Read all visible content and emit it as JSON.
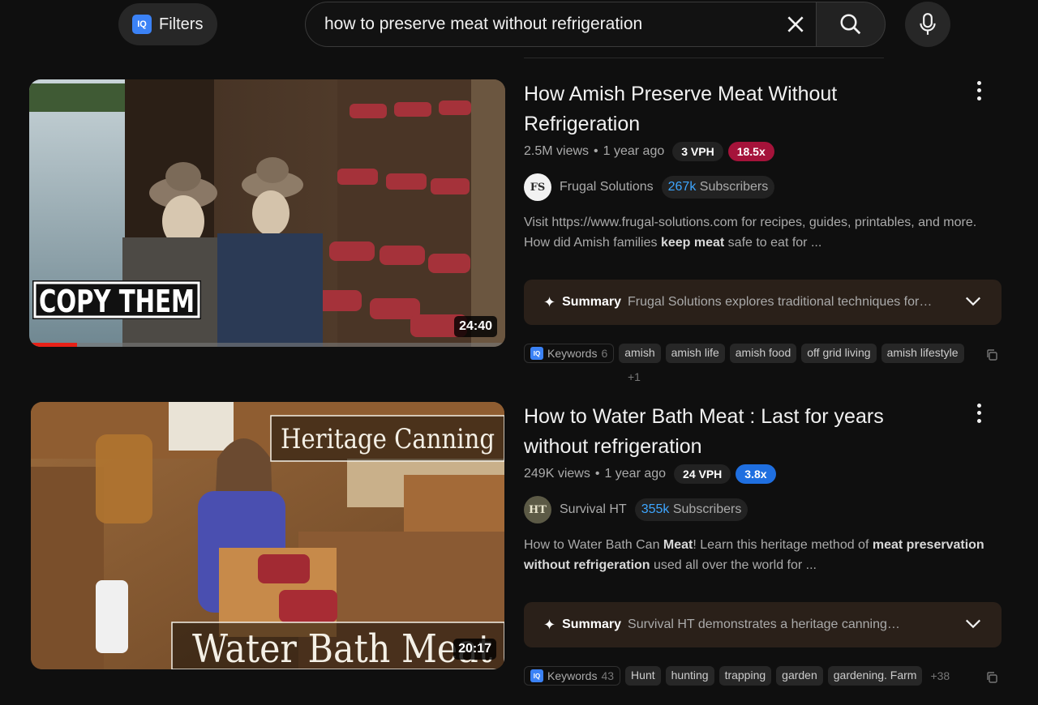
{
  "topbar": {
    "filters_label": "Filters",
    "iq_badge": "IQ",
    "search_value": "how to preserve meat without refrigeration"
  },
  "videos": [
    {
      "title": "How Amish Preserve Meat Without Refrigeration",
      "views": "2.5M views",
      "age": "1 year ago",
      "vph": "3 VPH",
      "multiplier": "18.5x",
      "multiplier_color": "#a5133a",
      "channel": "Frugal Solutions",
      "avatar_text": "FS",
      "subs_count": "267k",
      "subs_label": "Subscribers",
      "desc_parts": [
        "Visit https://www.frugal-solutions.com for recipes, guides, printables, and more. How did Amish families ",
        "keep meat",
        " safe to eat for ..."
      ],
      "duration": "24:40",
      "thumb_overlay": "COPY THEM",
      "watch_progress": 0.1,
      "summary_label": "Summary",
      "summary_text": "Frugal Solutions explores traditional techniques for…",
      "keywords_label": "Keywords",
      "keywords_count": "6",
      "keywords": [
        "amish",
        "amish life",
        "amish food",
        "off grid living",
        "amish lifestyle"
      ],
      "keywords_more": "+1"
    },
    {
      "title": "How to Water Bath Meat : Last for years without refrigeration",
      "views": "249K views",
      "age": "1 year ago",
      "vph": "24 VPH",
      "multiplier": "3.8x",
      "multiplier_color": "#1f6fe0",
      "channel": "Survival HT",
      "avatar_text": "HT",
      "subs_count": "355k",
      "subs_label": "Subscribers",
      "desc_parts": [
        "How to Water Bath Can ",
        "Meat",
        "! Learn this heritage method of ",
        "meat preservation without refrigeration",
        " used all over the world for ..."
      ],
      "duration": "20:17",
      "thumb_overlay_top": "Heritage Canning",
      "thumb_overlay_bottom": "Water Bath Meat",
      "summary_label": "Summary",
      "summary_text": "Survival HT demonstrates a heritage canning…",
      "keywords_label": "Keywords",
      "keywords_count": "43",
      "keywords": [
        "Hunt",
        "hunting",
        "trapping",
        "garden",
        "gardening. Farm"
      ],
      "keywords_more": "+38"
    }
  ]
}
